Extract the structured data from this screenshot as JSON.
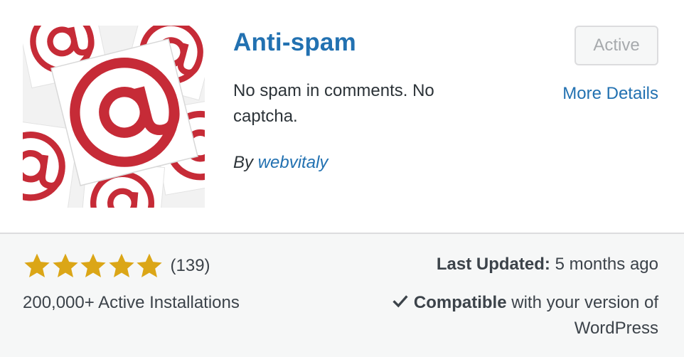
{
  "plugin": {
    "name": "Anti-spam",
    "description": "No spam in comments. No captcha.",
    "author_prefix": "By",
    "author": "webvitaly",
    "icon": "at-sign-icon",
    "status_button": "Active",
    "more_details": "More Details"
  },
  "footer": {
    "rating_stars": 5,
    "rating_max": 5,
    "rating_count": "(139)",
    "installs": "200,000+ Active Installations",
    "last_updated_label": "Last Updated:",
    "last_updated_value": "5 months ago",
    "compatible_label": "Compatible",
    "compatible_rest": "with your version of WordPress"
  },
  "colors": {
    "link": "#2271b1",
    "star": "#dba617",
    "icon_red": "#c62b37"
  }
}
